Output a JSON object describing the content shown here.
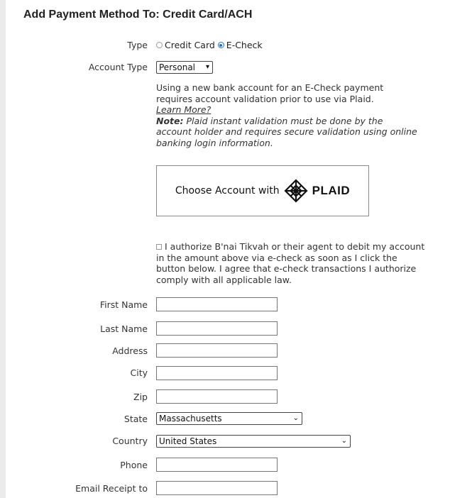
{
  "form": {
    "title": "Add Payment Method To: Credit Card/ACH",
    "type": {
      "label": "Type",
      "options": [
        "Credit Card",
        "E-Check"
      ],
      "selected": "E-Check"
    },
    "account_type": {
      "label": "Account Type",
      "value": "Personal"
    },
    "info": {
      "text": "Using a new bank account for an E-Check payment requires account validation prior to use via Plaid.",
      "learn_more": "Learn More?",
      "note_label": "Note:",
      "note_text": " Plaid instant validation must be done by the account holder and requires secure validation using online banking login information."
    },
    "plaid_button": {
      "label": "Choose Account with",
      "brand": "PLAID"
    },
    "authorization": "I authorize B'nai Tikvah or their agent to debit my account in the amount above via e-check as soon as I click the button below. I agree that e-check transactions I authorize comply with all applicable law.",
    "fields": {
      "first_name": "First Name",
      "last_name": "Last Name",
      "address": "Address",
      "city": "City",
      "zip": "Zip",
      "state": {
        "label": "State",
        "value": "Massachusetts"
      },
      "country": {
        "label": "Country",
        "value": "United States"
      },
      "phone": "Phone",
      "email": "Email Receipt to"
    }
  },
  "icons": {
    "plaid_logo": "plaid-logo-icon",
    "select_arrow": "chevron-down-icon"
  }
}
